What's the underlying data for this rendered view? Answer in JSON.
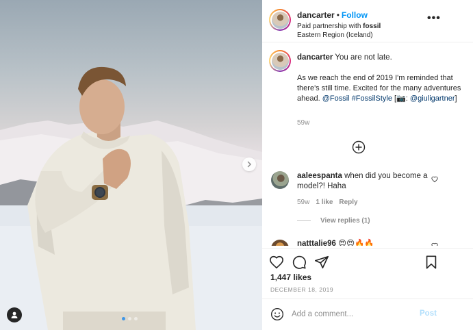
{
  "post": {
    "username": "dancarter",
    "follow_label": "Follow",
    "paid_partnership_prefix": "Paid partnership with",
    "partner": "fossil",
    "location": "Eastern Region (Iceland)",
    "more_label": "•••"
  },
  "caption": {
    "username": "dancarter",
    "first_line": "You are not late.",
    "body": "As we reach the end of 2019 I'm reminded that there's still time. Excited for the many adventures ahead.",
    "tags": {
      "fossil": "@Fossil",
      "hashtag": "#FossilStyle",
      "camera_open": "[📷:",
      "photographer": "@giuligartner",
      "camera_close": "]"
    },
    "time": "59w"
  },
  "comments": [
    {
      "username": "aaleespanta",
      "text": "when did you become a model?! Haha",
      "time": "59w",
      "likes": "1 like",
      "reply_label": "Reply",
      "view_replies": "View replies (1)"
    },
    {
      "username": "natttalie96",
      "text": "😍😍🔥🔥"
    }
  ],
  "engagement": {
    "likes": "1,447 likes",
    "date": "DECEMBER 18, 2019"
  },
  "compose": {
    "placeholder": "Add a comment...",
    "post_label": "Post"
  },
  "carousel": {
    "slide_count": 3,
    "active_index": 0
  },
  "colors": {
    "link": "#00376b",
    "follow": "#0095f6",
    "muted": "#8e8e8e",
    "post_disabled": "#b2dffc"
  }
}
